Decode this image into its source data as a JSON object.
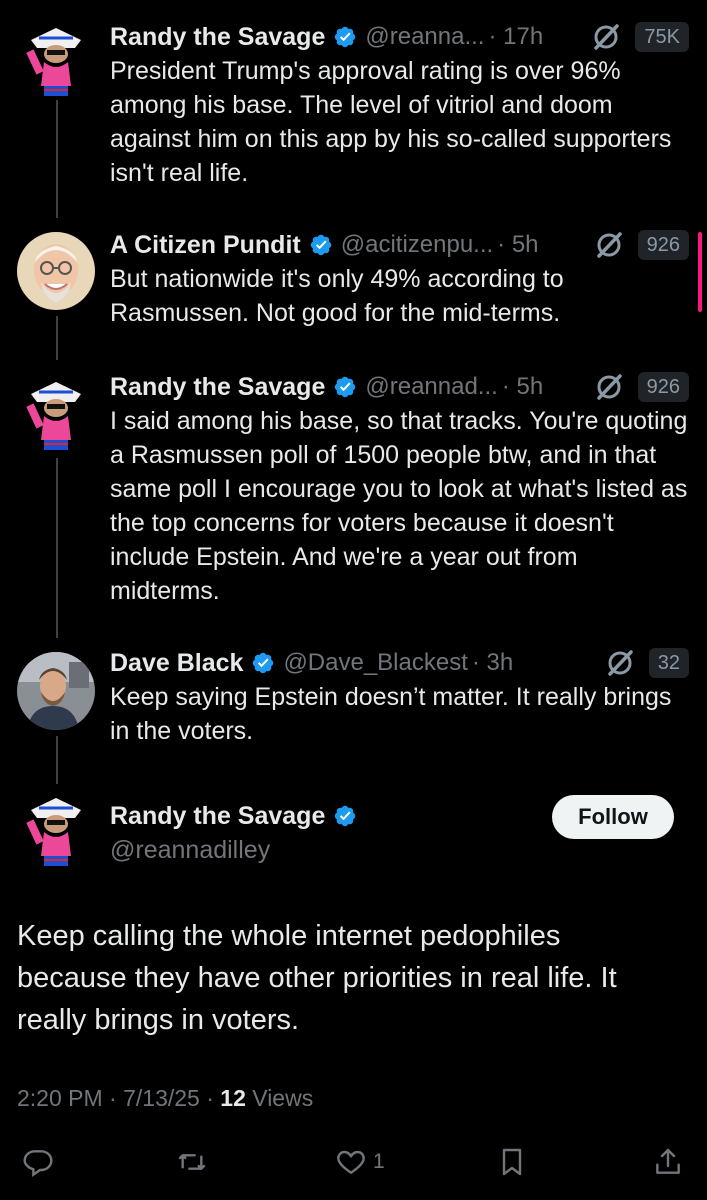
{
  "colors": {
    "background": "#000000",
    "text": "#e7e9ea",
    "muted": "#71767b",
    "verified": "#1d9bf0",
    "accent": "#f91880"
  },
  "thread": [
    {
      "name": "Randy the Savage",
      "handle": "@reanna...",
      "time": "· 17h",
      "count": "75K",
      "text": "President Trump's approval rating is over 96% among his base. The level of vitriol and doom against him on this app by his so-called supporters isn't real life."
    },
    {
      "name": "A Citizen Pundit",
      "handle": "@acitizenpu...",
      "time": "· 5h",
      "count": "926",
      "text": "But nationwide it's only 49% according to Rasmussen. Not good for the mid-terms."
    },
    {
      "name": "Randy the Savage",
      "handle": "@reannad...",
      "time": "· 5h",
      "count": "926",
      "text": "I said among his base, so that tracks. You're quoting a Rasmussen poll of 1500 people btw, and in that same poll I encourage you to look at what's listed as the top concerns for voters because it doesn't include Epstein. And we're a year out from midterms."
    },
    {
      "name": "Dave Black",
      "handle": "@Dave_Blackest",
      "time": "· 3h",
      "count": "32",
      "text": "Keep saying Epstein doesn’t matter. It really brings in the voters."
    }
  ],
  "main_tweet": {
    "name": "Randy the Savage",
    "handle": "@reannadilley",
    "follow_label": "Follow",
    "text": "Keep calling the whole internet pedophiles because they have other priorities in real life. It really brings in voters.",
    "time": "2:20 PM · 7/13/25 · ",
    "views_count": "12",
    "views_label": " Views"
  },
  "actions": {
    "reply_icon": "reply-icon",
    "repost_icon": "repost-icon",
    "like_icon": "heart-icon",
    "like_count": "1",
    "bookmark_icon": "bookmark-icon",
    "share_icon": "share-icon"
  }
}
